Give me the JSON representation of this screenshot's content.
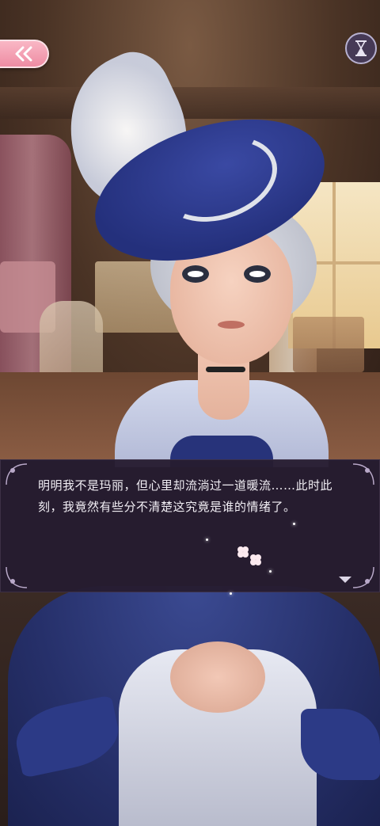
{
  "top_bar": {
    "back_icon": "double-chevron-left-icon",
    "timer_icon": "hourglass-icon"
  },
  "dialog": {
    "text": "明明我不是玛丽，但心里却流淌过一道暖流……此时此刻，我竟然有些分不清楚这究竟是谁的情绪了。",
    "advance_icon": "triangle-down-icon",
    "ornament_icon": "clover-flower-icon"
  },
  "colors": {
    "back_button": "#ee8ca3",
    "dialog_bg": "#261c30",
    "gown_blue": "#26306a"
  }
}
